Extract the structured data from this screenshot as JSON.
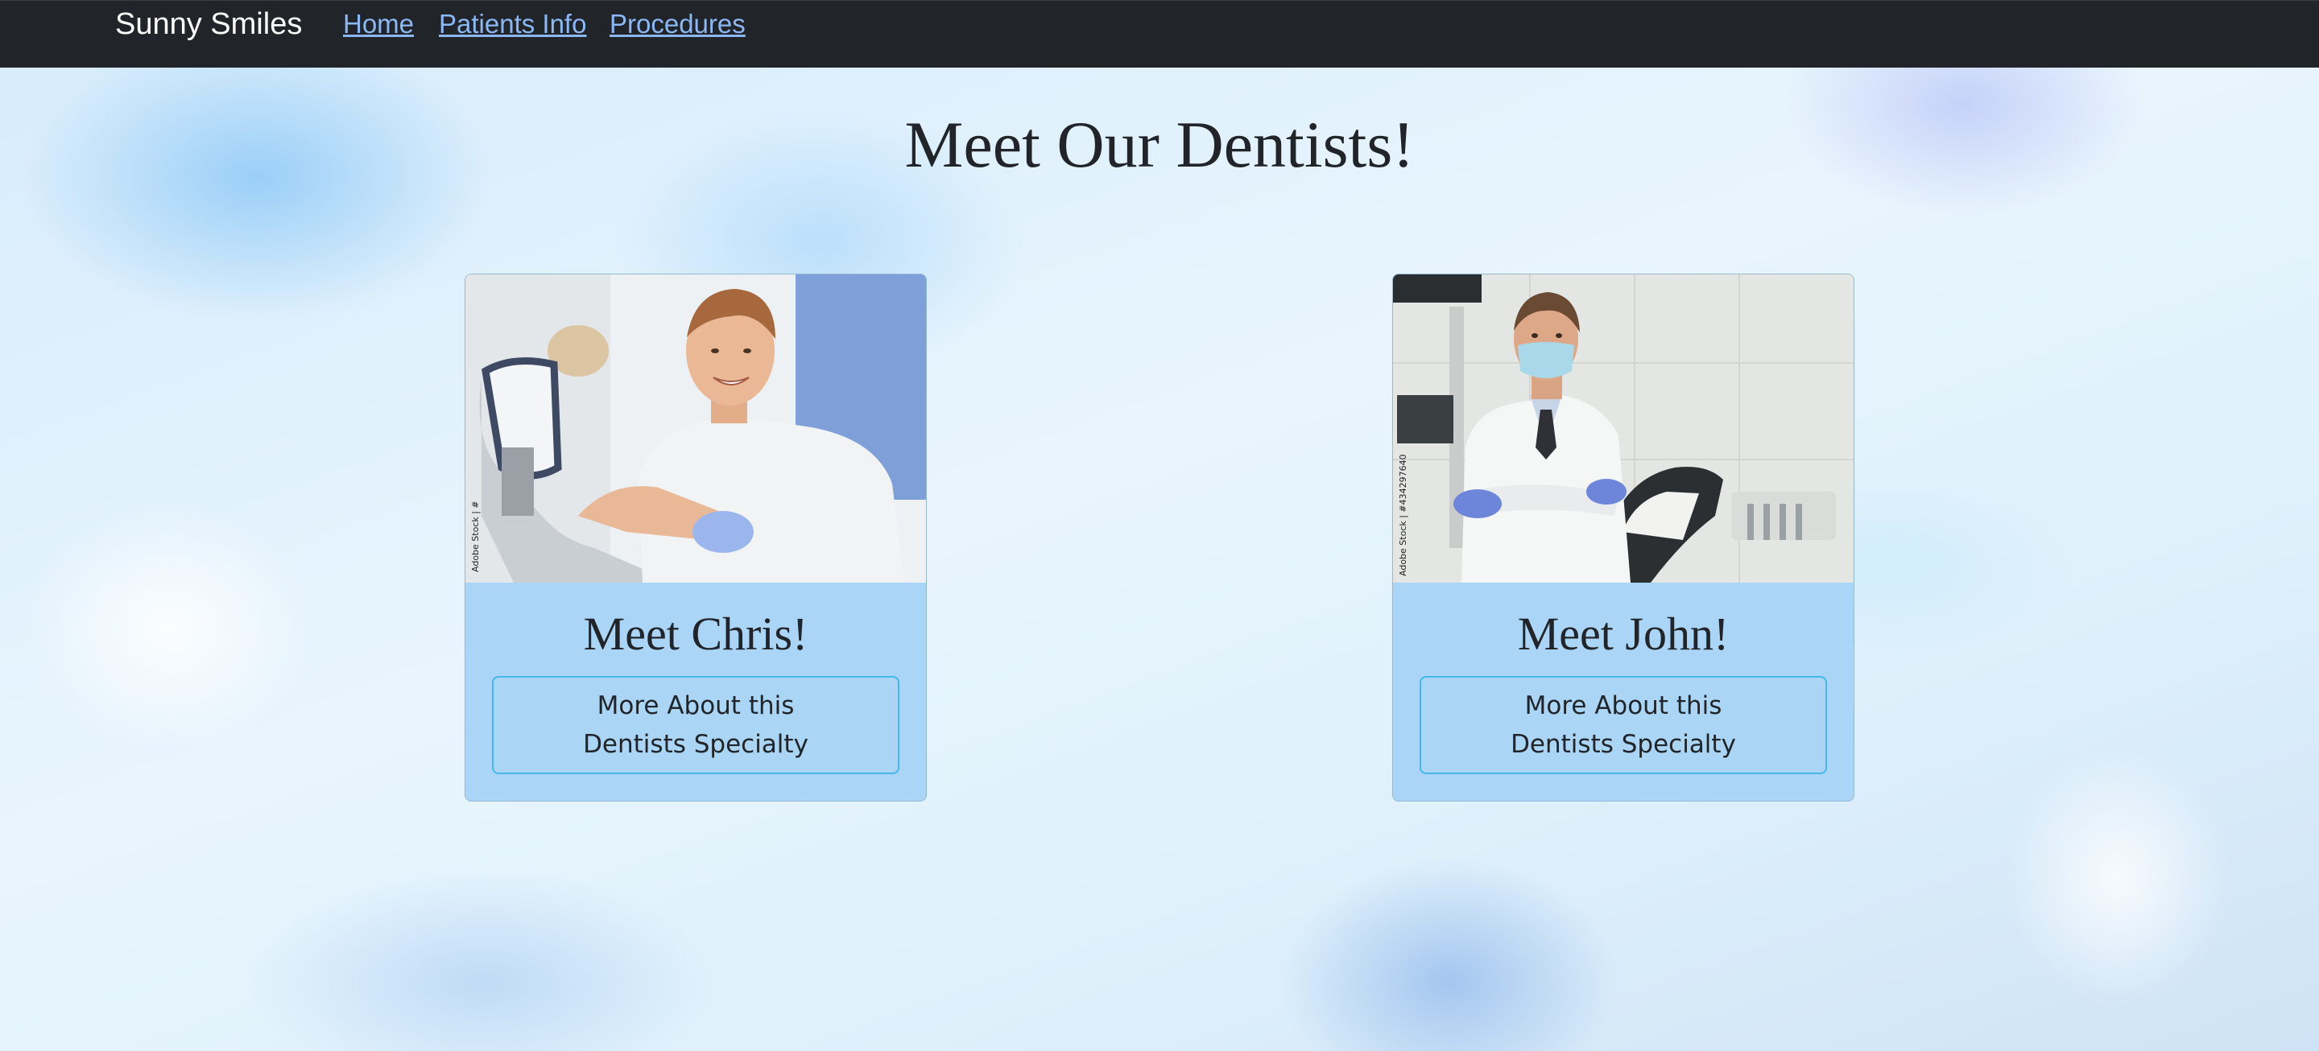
{
  "navbar": {
    "brand": "Sunny Smiles",
    "links": [
      {
        "label": "Home"
      },
      {
        "label": "Patients Info"
      },
      {
        "label": "Procedures"
      }
    ]
  },
  "main": {
    "title": "Meet Our Dentists!",
    "cards": [
      {
        "title": "Meet Chris!",
        "button_label": "More About this Dentists Specialty",
        "photo_watermark": "Adobe Stock | #"
      },
      {
        "title": "Meet John!",
        "button_label": "More About this Dentists Specialty",
        "photo_watermark": "Adobe Stock | #434297640"
      }
    ]
  },
  "colors": {
    "navbar_bg": "#212529",
    "nav_link": "#8bb8f5",
    "card_bg": "#aad5f6",
    "button_border": "#44b8ea",
    "text": "#212529"
  }
}
